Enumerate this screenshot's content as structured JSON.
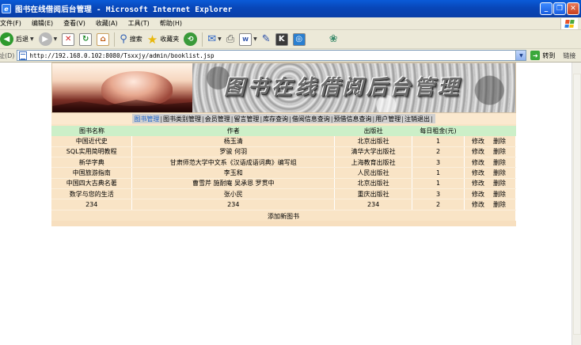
{
  "window": {
    "title": "图书在线借阅后台管理 - Microsoft Internet Explorer",
    "icon": "ie-icon",
    "buttons": [
      "minimize-icon",
      "maximize-icon",
      "close-icon"
    ]
  },
  "menu": {
    "items": [
      "文件(F)",
      "编辑(E)",
      "查看(V)",
      "收藏(A)",
      "工具(T)",
      "帮助(H)"
    ]
  },
  "toolbar": {
    "back_label": "后退",
    "search_label": "搜索",
    "favorites_label": "收藏夹"
  },
  "address": {
    "label": "地址(D)",
    "url": "http://192.168.0.102:8080/Tsxxjy/admin/booklist.jsp",
    "go_label": "转到",
    "links_label": "链接"
  },
  "banner": {
    "heading": "图书在线借阅后台管理"
  },
  "nav": {
    "items": [
      "图书管理",
      "图书类别管理",
      "会员管理",
      "留言管理",
      "库存查询",
      "借阅信息查询",
      "预借信息查询",
      "用户管理",
      "注销退出"
    ]
  },
  "table": {
    "headers": [
      "图书名称",
      "作者",
      "出版社",
      "每日租金(元)"
    ],
    "rows": [
      {
        "name": "中国近代史",
        "author": "杨玉清",
        "publisher": "北京出版社",
        "rent": "1",
        "edit": "修改",
        "delete": "删除"
      },
      {
        "name": "SQL实用简明教程",
        "author": "罗骏 何羽",
        "publisher": "清华大学出版社",
        "rent": "2",
        "edit": "修改",
        "delete": "删除"
      },
      {
        "name": "新华字典",
        "author": "甘肃师范大学中文系《汉语成语词典》编写组",
        "publisher": "上海教育出版社",
        "rent": "3",
        "edit": "修改",
        "delete": "删除"
      },
      {
        "name": "中国旅游指南",
        "author": "李玉和",
        "publisher": "人民出版社",
        "rent": "1",
        "edit": "修改",
        "delete": "删除"
      },
      {
        "name": "中国四大古典名著",
        "author": "曹雪芹 施耐庵 吴承恩 罗贯中",
        "publisher": "北京出版社",
        "rent": "1",
        "edit": "修改",
        "delete": "删除"
      },
      {
        "name": "数学与您的生活",
        "author": "张小民",
        "publisher": "重庆出版社",
        "rent": "3",
        "edit": "修改",
        "delete": "删除"
      },
      {
        "name": "234",
        "author": "234",
        "publisher": "234",
        "rent": "2",
        "edit": "修改",
        "delete": "删除"
      }
    ],
    "add_link": "添加新图书"
  },
  "colors": {
    "titlebar": "#0846b8",
    "chrome": "#ece9d8",
    "panel": "#f9e4c6",
    "table_header": "#ccefc8",
    "nav_bar": "#cfcfcf",
    "nav_active": "#1c63c9"
  }
}
